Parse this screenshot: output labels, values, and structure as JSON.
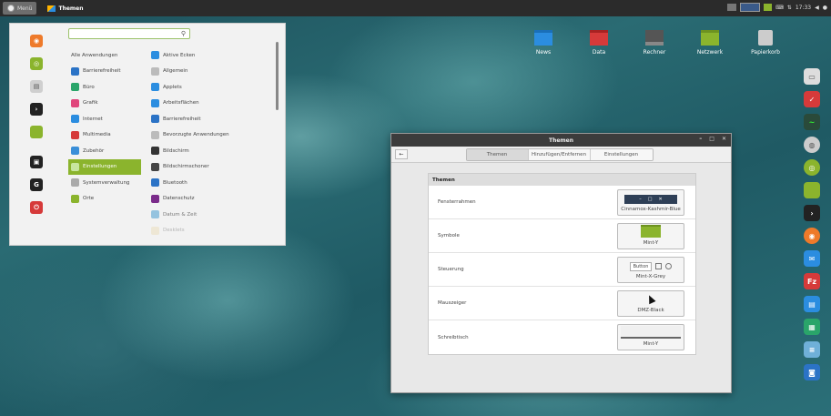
{
  "panel": {
    "menu_label": "Menü",
    "active_window": "Themen",
    "clock": "17:33"
  },
  "search": {
    "placeholder": "",
    "value": ""
  },
  "categories": [
    {
      "label": "Alle Anwendungen",
      "color": ""
    },
    {
      "label": "Barrierefreiheit",
      "color": "#2b73c6"
    },
    {
      "label": "Büro",
      "color": "#2aa56a"
    },
    {
      "label": "Grafik",
      "color": "#e0467c"
    },
    {
      "label": "Internet",
      "color": "#2b8de0"
    },
    {
      "label": "Multimedia",
      "color": "#d63a3a"
    },
    {
      "label": "Zubehör",
      "color": "#3a8ed8"
    },
    {
      "label": "Einstellungen",
      "color": "#c8e6a0"
    },
    {
      "label": "Systemverwaltung",
      "color": "#aaaaaa"
    },
    {
      "label": "Orte",
      "color": "#8bb42d"
    }
  ],
  "apps": [
    {
      "label": "Aktive Ecken",
      "color": "#2b8de0"
    },
    {
      "label": "Allgemein",
      "color": "#bbbbbb"
    },
    {
      "label": "Applets",
      "color": "#2b8de0"
    },
    {
      "label": "Arbeitsflächen",
      "color": "#2b8de0"
    },
    {
      "label": "Barrierefreiheit",
      "color": "#2b73c6"
    },
    {
      "label": "Bevorzugte Anwendungen",
      "color": "#bbbbbb"
    },
    {
      "label": "Bildschirm",
      "color": "#333333"
    },
    {
      "label": "Bildschirmschoner",
      "color": "#444444"
    },
    {
      "label": "Bluetooth",
      "color": "#2b73c6"
    },
    {
      "label": "Datenschutz",
      "color": "#7a2b8a"
    },
    {
      "label": "Datum & Zeit",
      "color": "#6fb0d8"
    },
    {
      "label": "Desklets",
      "color": "#e8d4a0"
    }
  ],
  "desktop_icons": [
    {
      "label": "News",
      "color": "#2b8de0"
    },
    {
      "label": "Data",
      "color": "#d63a3a"
    },
    {
      "label": "Rechner",
      "color": "#555555"
    },
    {
      "label": "Netzwerk",
      "color": "#8bb42d"
    },
    {
      "label": "Papierkorb",
      "color": "#cccccc"
    }
  ],
  "window": {
    "title": "Themen",
    "tabs": [
      "Themen",
      "Hinzufügen/Entfernen",
      "Einstellungen"
    ],
    "section_title": "Themen",
    "rows": [
      {
        "label": "Fensterrahmen",
        "value": "Cinnamox-Kashmir-Blue"
      },
      {
        "label": "Symbole",
        "value": "Mint-Y"
      },
      {
        "label": "Steuerung",
        "value": "Mint-X-Grey"
      },
      {
        "label": "Mauszeiger",
        "value": "DMZ-Black"
      },
      {
        "label": "Schreibtisch",
        "value": "Mint-Y"
      }
    ],
    "preview_button_text": "Button"
  }
}
